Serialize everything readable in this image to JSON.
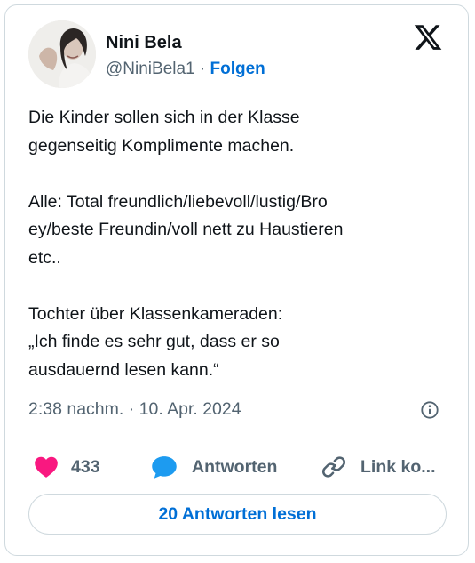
{
  "user": {
    "display_name": "Nini Bela",
    "handle": "@NiniBela1",
    "separator": " · ",
    "follow_label": "Folgen"
  },
  "tweet": {
    "text": "Die Kinder sollen sich in der Klasse\ngegenseitig Komplimente machen.\n\nAlle: Total freundlich/liebevoll/lustig/Bro\ney/beste Freundin/voll nett zu Haustieren\netc..\n\nTochter über Klassenkameraden:\n„Ich finde es sehr gut, dass er so\nausdauernd lesen kann.“",
    "timestamp": "2:38 nachm. · 10. Apr. 2024"
  },
  "actions": {
    "like_count": "433",
    "reply_label": "Antworten",
    "link_label": "Link ko..."
  },
  "read_replies_label": "20 Antworten lesen",
  "icons": {
    "brand": "x-logo-icon",
    "info": "info-icon",
    "like": "heart-icon",
    "reply": "speech-bubble-icon",
    "link": "link-icon"
  },
  "colors": {
    "accent": "#006fd6",
    "heart": "#f91880",
    "reply_icon": "#1d9bf0",
    "muted_text": "#536471",
    "border": "#cfd9de"
  }
}
